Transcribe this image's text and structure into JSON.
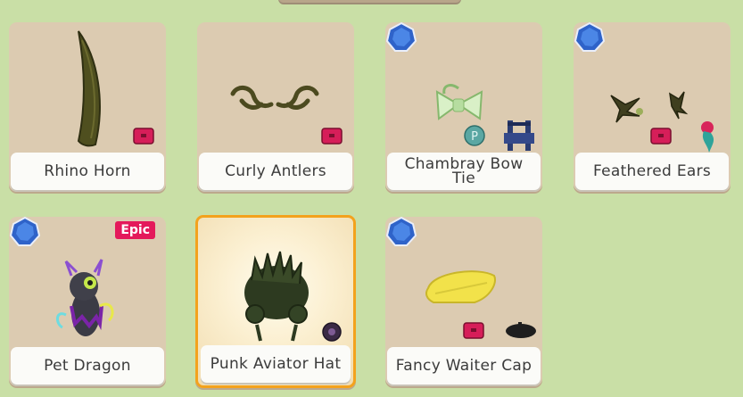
{
  "items": [
    {
      "name": "Rhino Horn",
      "gem": false,
      "epic": false,
      "selected": false
    },
    {
      "name": "Curly Antlers",
      "gem": false,
      "epic": false,
      "selected": false
    },
    {
      "name": "Chambray Bow Tie",
      "gem": true,
      "epic": false,
      "selected": false
    },
    {
      "name": "Feathered Ears",
      "gem": true,
      "epic": false,
      "selected": false
    },
    {
      "name": "Pet Dragon",
      "gem": true,
      "epic": true,
      "selected": false
    },
    {
      "name": "Punk Aviator Hat",
      "gem": false,
      "epic": false,
      "selected": true
    },
    {
      "name": "Fancy Waiter Cap",
      "gem": true,
      "epic": false,
      "selected": false
    }
  ],
  "badge": {
    "epic_label": "Epic"
  },
  "colors": {
    "background": "#c9dfa6",
    "card": "#dccbb1",
    "selected_border": "#f3a21d",
    "epic": "#e4195b",
    "gem": "#2f63c9"
  }
}
